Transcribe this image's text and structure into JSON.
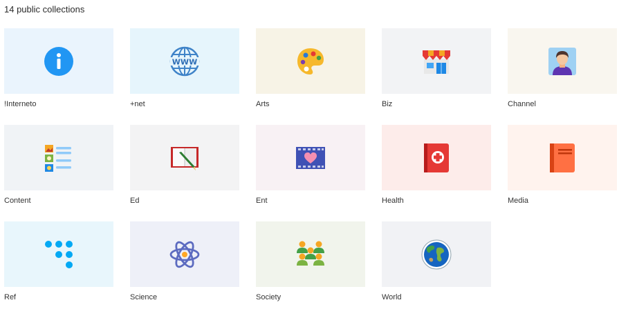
{
  "heading": "14 public collections",
  "collections": [
    {
      "label": "!Interneto",
      "icon": "info-icon",
      "bg": "#eaf4fd"
    },
    {
      "label": "+net",
      "icon": "globe-www-icon",
      "bg": "#e6f5fc"
    },
    {
      "label": "Arts",
      "icon": "palette-icon",
      "bg": "#f7f3e6"
    },
    {
      "label": "Biz",
      "icon": "storefront-icon",
      "bg": "#f2f3f5"
    },
    {
      "label": "Channel",
      "icon": "user-portrait-icon",
      "bg": "#f9f6ef"
    },
    {
      "label": "Content",
      "icon": "content-list-icon",
      "bg": "#f0f3f6"
    },
    {
      "label": "Ed",
      "icon": "book-pencil-icon",
      "bg": "#f3f3f4"
    },
    {
      "label": "Ent",
      "icon": "film-heart-icon",
      "bg": "#f8f1f4"
    },
    {
      "label": "Health",
      "icon": "medical-book-icon",
      "bg": "#fdecea"
    },
    {
      "label": "Media",
      "icon": "notebook-icon",
      "bg": "#fff3ee"
    },
    {
      "label": "Ref",
      "icon": "dots-pattern-icon",
      "bg": "#e8f6fc"
    },
    {
      "label": "Science",
      "icon": "atom-icon",
      "bg": "#eef0f8"
    },
    {
      "label": "Society",
      "icon": "people-group-icon",
      "bg": "#f1f4ec"
    },
    {
      "label": "World",
      "icon": "world-globe-icon",
      "bg": "#f1f2f5"
    }
  ]
}
